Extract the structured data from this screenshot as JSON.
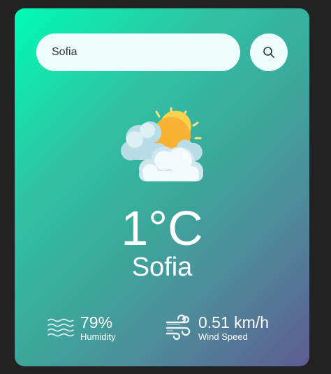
{
  "search": {
    "value": "Sofia",
    "placeholder": "",
    "button_icon": "search-icon"
  },
  "weather": {
    "icon": "partly-cloudy-sun-icon",
    "temperature": "1°C",
    "city": "Sofia"
  },
  "details": {
    "humidity": {
      "icon": "humidity-waves-icon",
      "value": "79%",
      "label": "Humidity"
    },
    "wind": {
      "icon": "wind-icon",
      "value": "0.51 km/h",
      "label": "Wind Speed"
    }
  },
  "colors": {
    "background": "#222222",
    "gradient_start": "#00fcb4",
    "gradient_end": "#5d5c92",
    "pill": "#ecfdfb",
    "text": "#ffffff"
  }
}
